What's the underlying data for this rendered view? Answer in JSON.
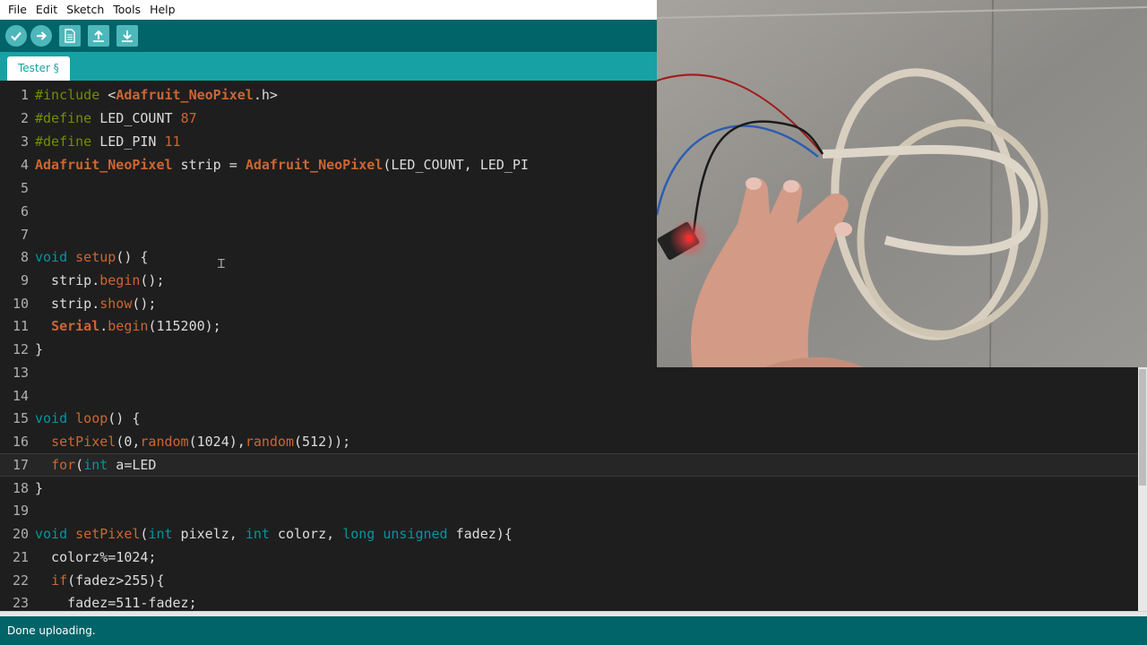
{
  "menu": [
    "File",
    "Edit",
    "Sketch",
    "Tools",
    "Help"
  ],
  "toolbar": {
    "verify_icon": "checkmark-icon",
    "upload_icon": "arrow-right-icon",
    "new_icon": "new-file-icon",
    "open_icon": "open-arrow-up-icon",
    "save_icon": "save-arrow-down-icon",
    "color": "#006468"
  },
  "tab": {
    "label": "Tester §"
  },
  "code": {
    "line_numbers": [
      "1",
      "2",
      "3",
      "4",
      "5",
      "6",
      "7",
      "8",
      "9",
      "10",
      "11",
      "12",
      "13",
      "14",
      "15",
      "16",
      "17",
      "18",
      "19",
      "20",
      "21",
      "22",
      "23"
    ],
    "current_line": "17",
    "line1": {
      "a": "#include",
      "b": " <",
      "c": "Adafruit_NeoPixel",
      "d": ".h>"
    },
    "line2": {
      "a": "#define",
      "b": " LED_COUNT ",
      "c": "87"
    },
    "line3": {
      "a": "#define",
      "b": " LED_PIN ",
      "c": "11"
    },
    "line4": {
      "a": "Adafruit_NeoPixel",
      "b": " strip = ",
      "c": "Adafruit_NeoPixel",
      "d": "(LED_COUNT, LED_PI"
    },
    "line8": {
      "a": "void",
      "b": " ",
      "c": "setup",
      "d": "() {"
    },
    "line9": {
      "a": "  strip.",
      "b": "begin",
      "c": "();"
    },
    "line10": {
      "a": "  strip.",
      "b": "show",
      "c": "();"
    },
    "line11": {
      "a": "  ",
      "b": "Serial",
      "c": ".",
      "d": "begin",
      "e": "(115200);"
    },
    "line12": {
      "a": "}"
    },
    "line15": {
      "a": "void",
      "b": " ",
      "c": "loop",
      "d": "() {"
    },
    "line16": {
      "a": "  ",
      "b": "setPixel",
      "c": "(0,",
      "d": "random",
      "e": "(1024),",
      "f": "random",
      "g": "(512));"
    },
    "line17": {
      "a": "  ",
      "b": "for",
      "c": "(",
      "d": "int",
      "e": " a=LED"
    },
    "line18": {
      "a": "}"
    },
    "line20": {
      "a": "void",
      "b": " ",
      "c": "setPixel",
      "d": "(",
      "e": "int",
      "f": " pixelz, ",
      "g": "int",
      "h": " colorz, ",
      "i": "long",
      "j": " ",
      "k": "unsigned",
      "l": " fadez){"
    },
    "line21": {
      "a": "  colorz%=1024;"
    },
    "line22": {
      "a": "  ",
      "b": "if",
      "c": "(fadez>255){"
    },
    "line23": {
      "a": "    fadez=511-fadez;"
    }
  },
  "status": {
    "message": "Done uploading."
  },
  "colors": {
    "keyword": "#cc6633",
    "preprocessor": "#728e00",
    "type": "#00979c",
    "background": "#1e1e1e"
  }
}
